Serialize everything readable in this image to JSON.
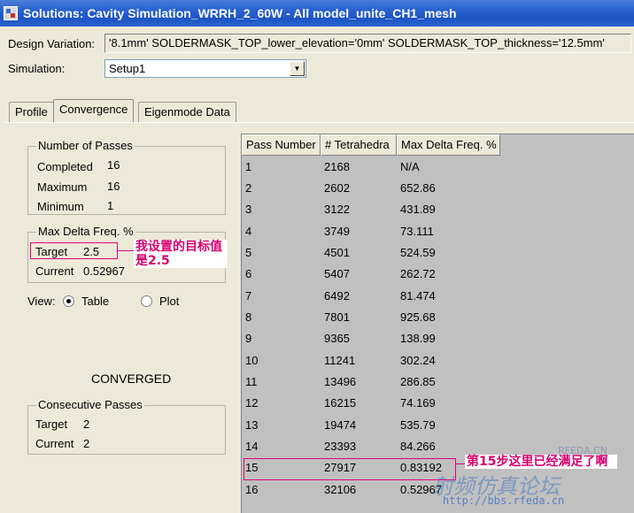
{
  "window": {
    "title": "Solutions: Cavity Simulation_WRRH_2_60W - All model_unite_CH1_mesh"
  },
  "design_variation": {
    "label": "Design Variation:",
    "value": "'8.1mm' SOLDERMASK_TOP_lower_elevation='0mm' SOLDERMASK_TOP_thickness='12.5mm'"
  },
  "simulation": {
    "label": "Simulation:",
    "value": "Setup1"
  },
  "tabs": [
    {
      "label": "Profile"
    },
    {
      "label": "Convergence"
    },
    {
      "label": "Eigenmode Data"
    }
  ],
  "passes": {
    "title": "Number of Passes",
    "completed_label": "Completed",
    "completed": "16",
    "maximum_label": "Maximum",
    "maximum": "16",
    "minimum_label": "Minimum",
    "minimum": "1"
  },
  "delta": {
    "title": "Max Delta Freq. %",
    "target_label": "Target",
    "target": "2.5",
    "current_label": "Current",
    "current": "0.52967"
  },
  "view": {
    "label": "View:",
    "table_label": "Table",
    "plot_label": "Plot",
    "selected": "Table"
  },
  "status": "CONVERGED",
  "consecutive": {
    "title": "Consecutive Passes",
    "target_label": "Target",
    "target": "2",
    "current_label": "Current",
    "current": "2"
  },
  "table": {
    "headers": [
      "Pass Number",
      "# Tetrahedra",
      "Max Delta Freq. %"
    ],
    "rows": [
      [
        "1",
        "2168",
        "N/A"
      ],
      [
        "2",
        "2602",
        "652.86"
      ],
      [
        "3",
        "3122",
        "431.89"
      ],
      [
        "4",
        "3749",
        "73.111"
      ],
      [
        "5",
        "4501",
        "524.59"
      ],
      [
        "6",
        "5407",
        "262.72"
      ],
      [
        "7",
        "6492",
        "81.474"
      ],
      [
        "8",
        "7801",
        "925.68"
      ],
      [
        "9",
        "9365",
        "138.99"
      ],
      [
        "10",
        "11241",
        "302.24"
      ],
      [
        "11",
        "13496",
        "286.85"
      ],
      [
        "12",
        "16215",
        "74.169"
      ],
      [
        "13",
        "19474",
        "535.79"
      ],
      [
        "14",
        "23393",
        "84.266"
      ],
      [
        "15",
        "27917",
        "0.83192"
      ],
      [
        "16",
        "32106",
        "0.52967"
      ]
    ]
  },
  "annotations": {
    "target_note": "我设置的目标值是2.5",
    "pass15_note": "第15步这里已经满足了啊"
  },
  "watermark": {
    "forum": "射频仿真论坛",
    "site": "RFEDA.CN",
    "url": "http://bbs.rfeda.cn"
  },
  "colors": {
    "titlebar": "#2a63d0",
    "annotation": "#e0007a",
    "table_bg": "#c0c0c0"
  }
}
